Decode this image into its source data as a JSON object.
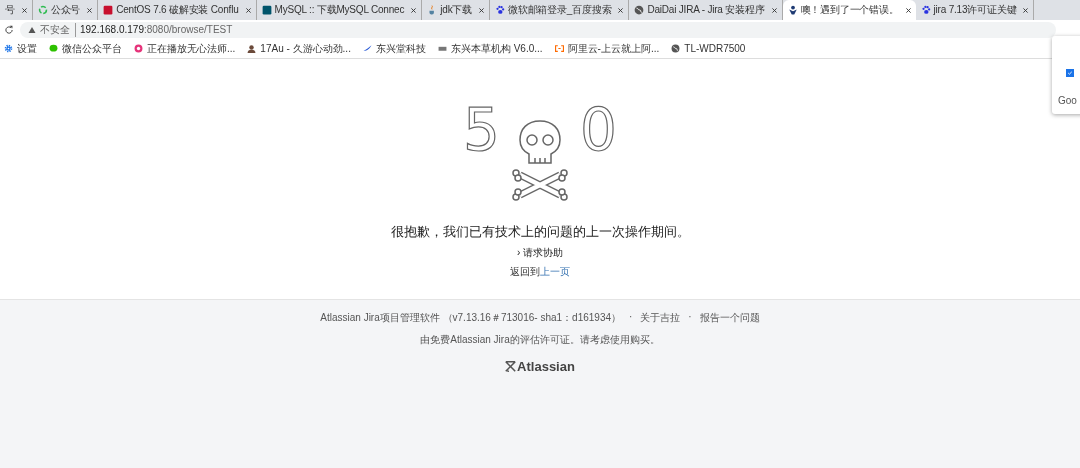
{
  "tabs": [
    {
      "title": "号",
      "selected": false
    },
    {
      "title": "公众号",
      "selected": false
    },
    {
      "title": "CentOS 7.6 破解安装 Conflu",
      "selected": false
    },
    {
      "title": "MySQL :: 下载MySQL Connec",
      "selected": false
    },
    {
      "title": "jdk下载",
      "selected": false
    },
    {
      "title": "微软邮箱登录_百度搜索",
      "selected": false
    },
    {
      "title": "DaiDai JIRA - Jira 安装程序",
      "selected": false
    },
    {
      "title": "噢！遇到了一个错误。",
      "selected": true
    },
    {
      "title": "jira 7.13许可证关键",
      "selected": false
    }
  ],
  "address_bar": {
    "security": "不安全",
    "host": "192.168.0.179",
    "path": ":8080/browse/TEST"
  },
  "bookmarks": [
    {
      "label": "设置"
    },
    {
      "label": "微信公众平台"
    },
    {
      "label": "正在播放无心法师..."
    },
    {
      "label": "17Au - 久游心动劲..."
    },
    {
      "label": "东兴堂科技"
    },
    {
      "label": "东兴本草机构 V6.0..."
    },
    {
      "label": "阿里云-上云就上阿..."
    },
    {
      "label": "TL-WDR7500"
    }
  ],
  "popup": {
    "checked": true,
    "text": "Goo"
  },
  "error": {
    "digits": [
      "5",
      "0"
    ],
    "message": "很抱歉，我们已有技术上的问题的上一次操作期间。",
    "help_chevron": "›",
    "help_link": "请求协助",
    "back_prefix": "返回到",
    "back_link": "上一页"
  },
  "footer": {
    "product": "Atlassian Jira项目管理软件 （v7.13.16＃713016- sha1：d161934）",
    "links": [
      {
        "separator": "·",
        "label": "关于吉拉"
      },
      {
        "separator": "·",
        "label": "报告一个问题"
      }
    ],
    "license": "由免费Atlassian Jira的评估许可证。请考虑使用购买。",
    "logo": "Atlassian"
  }
}
